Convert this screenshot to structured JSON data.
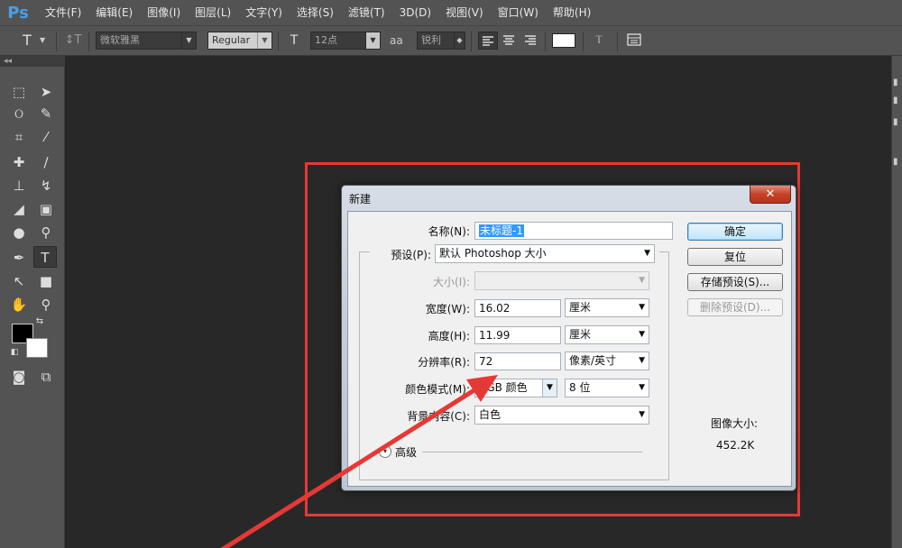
{
  "app": {
    "logo": "Ps"
  },
  "menu": [
    "文件(F)",
    "编辑(E)",
    "图像(I)",
    "图层(L)",
    "文字(Y)",
    "选择(S)",
    "滤镜(T)",
    "3D(D)",
    "视图(V)",
    "窗口(W)",
    "帮助(H)"
  ],
  "options_bar": {
    "font_family": "微软雅黑",
    "font_style": "Regular",
    "font_size": "12点",
    "antialias_label": "aa",
    "antialias": "锐利"
  },
  "toolbar": {
    "collapse": "◂◂"
  },
  "dialog": {
    "title": "新建",
    "close": "✕",
    "name_label": "名称(N):",
    "name_value": "未标题-1",
    "preset_label": "预设(P):",
    "preset_value": "默认 Photoshop 大小",
    "size_label": "大小(I):",
    "size_value": "",
    "width_label": "宽度(W):",
    "width_value": "16.02",
    "width_unit": "厘米",
    "height_label": "高度(H):",
    "height_value": "11.99",
    "height_unit": "厘米",
    "resolution_label": "分辨率(R):",
    "resolution_value": "72",
    "resolution_unit": "像素/英寸",
    "color_mode_label": "颜色模式(M):",
    "color_mode_value": "RGB 颜色",
    "bit_depth": "8 位",
    "background_label": "背景内容(C):",
    "background_value": "白色",
    "advanced_label": "高级",
    "buttons": {
      "ok": "确定",
      "reset": "复位",
      "save_preset": "存储预设(S)...",
      "delete_preset": "删除预设(D)..."
    },
    "image_size_label": "图像大小:",
    "image_size_value": "452.2K"
  },
  "colors": {
    "annotation": "#e53935",
    "foreground": "#000000",
    "background": "#ffffff"
  }
}
